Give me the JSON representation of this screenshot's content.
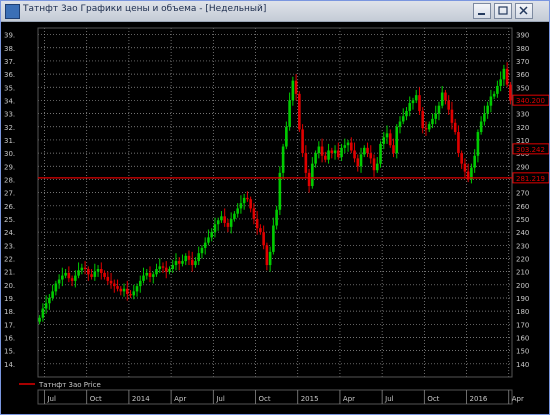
{
  "window": {
    "title": "Татнфт 3ао Графики цены и объема - [Недельный]",
    "minimize_icon": "minimize-icon",
    "restore_icon": "restore-icon",
    "close_icon": "close-icon"
  },
  "colors": {
    "background": "#000000",
    "grid": "#9a9a9a",
    "up": "#00cc00",
    "down": "#e00000",
    "price_marker": "#e00000",
    "axis_text": "#c8c8c8"
  },
  "price_markers": [
    {
      "label": "340.200",
      "value": 340.2
    },
    {
      "label": "303.242",
      "value": 303.242
    },
    {
      "label": "281.219",
      "value": 281.219
    }
  ],
  "legend": {
    "label": "Татнфт 3ао Price"
  },
  "chart_data": {
    "type": "candlestick",
    "ylim": [
      130,
      395
    ],
    "grid": true,
    "y_ticks_right": [
      140,
      150,
      160,
      170,
      180,
      190,
      200,
      210,
      220,
      230,
      240,
      250,
      260,
      270,
      280,
      290,
      300,
      310,
      320,
      330,
      340,
      350,
      360,
      370,
      380,
      390
    ],
    "y_ticks_left": [
      "14.",
      "15.",
      "16.",
      "17.",
      "18.",
      "19.",
      "20.",
      "21.",
      "22.",
      "23.",
      "24.",
      "25.",
      "26.",
      "27.",
      "28.",
      "29.",
      "30.",
      "31.",
      "32.",
      "33.",
      "34.",
      "35.",
      "36.",
      "37.",
      "38.",
      "39."
    ],
    "x_labels": [
      {
        "label": "Jul",
        "week": 2
      },
      {
        "label": "Oct",
        "week": 15
      },
      {
        "label": "2014",
        "week": 28
      },
      {
        "label": "Apr",
        "week": 41
      },
      {
        "label": "Jul",
        "week": 54
      },
      {
        "label": "Oct",
        "week": 67
      },
      {
        "label": "2015",
        "week": 80
      },
      {
        "label": "Apr",
        "week": 93
      },
      {
        "label": "Jul",
        "week": 106
      },
      {
        "label": "Oct",
        "week": 119
      },
      {
        "label": "2016",
        "week": 132
      },
      {
        "label": "Apr",
        "week": 145
      }
    ],
    "closes": [
      175,
      182,
      186,
      190,
      195,
      201,
      204,
      207,
      209,
      205,
      203,
      207,
      211,
      213,
      212,
      208,
      206,
      210,
      212,
      209,
      206,
      203,
      201,
      199,
      197,
      195,
      197,
      193,
      192,
      195,
      199,
      203,
      207,
      209,
      206,
      208,
      212,
      214,
      213,
      210,
      212,
      215,
      218,
      216,
      218,
      222,
      219,
      215,
      218,
      224,
      228,
      232,
      236,
      240,
      246,
      249,
      252,
      247,
      244,
      250,
      254,
      258,
      262,
      266,
      265,
      258,
      250,
      243,
      240,
      230,
      215,
      225,
      245,
      257,
      285,
      305,
      320,
      340,
      355,
      345,
      318,
      300,
      285,
      275,
      292,
      300,
      305,
      298,
      295,
      302,
      300,
      302,
      297,
      304,
      306,
      308,
      302,
      296,
      290,
      299,
      304,
      300,
      296,
      287,
      292,
      307,
      312,
      315,
      306,
      300,
      320,
      324,
      328,
      332,
      338,
      340,
      344,
      332,
      319,
      318,
      322,
      326,
      330,
      336,
      346,
      340,
      333,
      323,
      316,
      300,
      292,
      286,
      280,
      289,
      298,
      316,
      324,
      330,
      336,
      343,
      345,
      351,
      356,
      364,
      352,
      340
    ]
  }
}
